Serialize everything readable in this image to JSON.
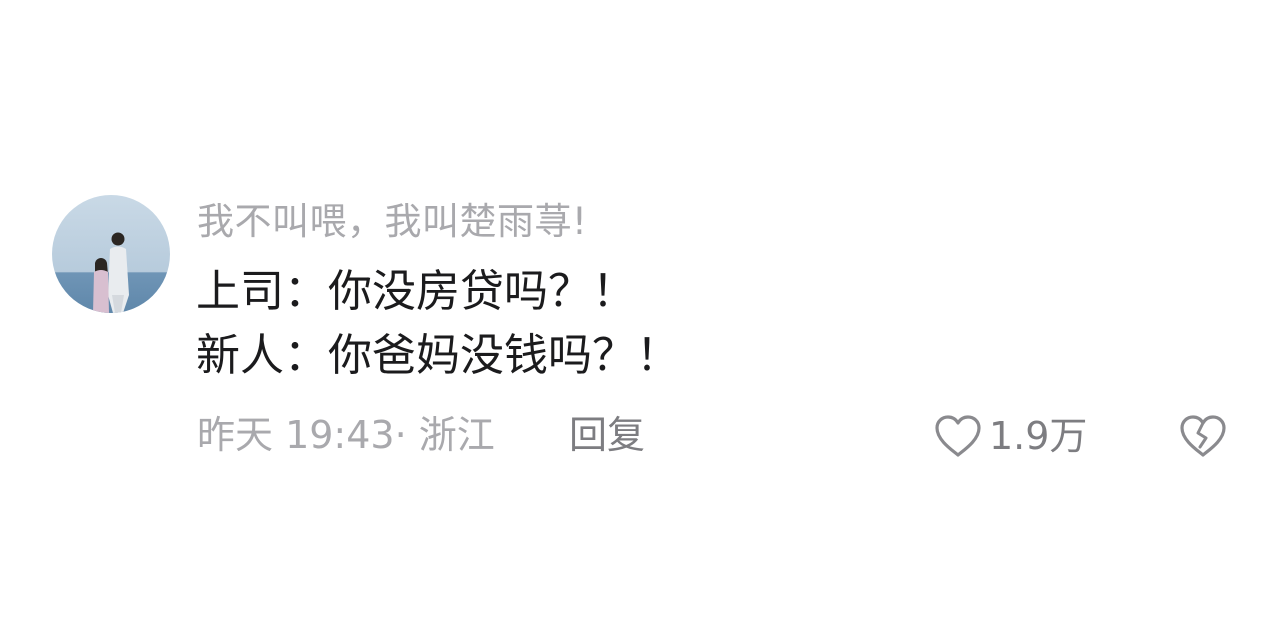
{
  "comment": {
    "username": "我不叫喂，我叫楚雨荨!",
    "lines": [
      "上司：你没房贷吗？！",
      "新人：你爸妈没钱吗？！"
    ],
    "meta": "昨天 19:43· 浙江",
    "reply_label": "回复",
    "like_count": "1.9万",
    "icons": {
      "like": "heart-outline-icon",
      "dislike": "broken-heart-icon"
    },
    "colors": {
      "meta_text": "#a9a9ad",
      "body_text": "#1b1b1d",
      "action_text": "#7d7d81",
      "icon_stroke": "#8a8a8e"
    }
  }
}
